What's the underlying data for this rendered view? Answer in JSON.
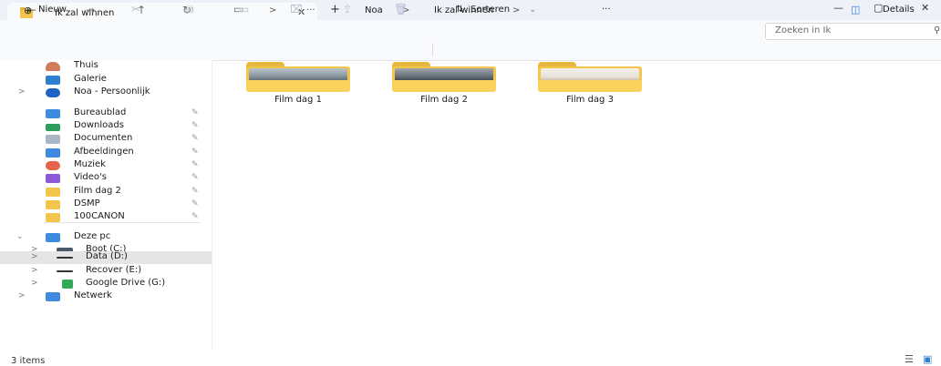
{
  "tab": {
    "title": "Ik zal winnen",
    "close": "✕",
    "add": "+"
  },
  "window": {
    "minimize": "—",
    "maximize": "▢",
    "close": "✕"
  },
  "nav": {
    "back": "←",
    "forward": "→",
    "up": "↑",
    "refresh": "↻",
    "view": "▭",
    "more": "···",
    "breadcrumb": [
      "Noa",
      "Ik zal winnen"
    ],
    "sep": ">"
  },
  "search": {
    "placeholder": "Zoeken in Ik",
    "icon": "search-icon"
  },
  "toolbar": {
    "new_label": "Nieuw",
    "sort_label": "Sorteren",
    "more": "···",
    "details_label": "Details"
  },
  "sidebar": {
    "top": [
      {
        "label": "Thuis",
        "color": "#d07b5a"
      },
      {
        "label": "Galerie",
        "color": "#2f7fd1"
      },
      {
        "label": "Noa - Persoonlijk",
        "color": "#1f64c4"
      }
    ],
    "pinned": [
      {
        "label": "Bureaublad",
        "color": "#3c8be0"
      },
      {
        "label": "Downloads",
        "color": "#2e9e5a"
      },
      {
        "label": "Documenten",
        "color": "#a9b6c8"
      },
      {
        "label": "Afbeeldingen",
        "color": "#3c8be0"
      },
      {
        "label": "Muziek",
        "color": "#e8624c"
      },
      {
        "label": "Video's",
        "color": "#8f57d9"
      },
      {
        "label": "Film dag 2",
        "color": "#f3c64b"
      },
      {
        "label": "DSMP",
        "color": "#f3c64b"
      },
      {
        "label": "100CANON",
        "color": "#f3c64b"
      }
    ],
    "this_pc": {
      "label": "Deze pc",
      "color": "#3c8be0"
    },
    "drives": [
      {
        "label": "Boot (C:)",
        "color": "#4a5a6a"
      },
      {
        "label": "Data (D:)",
        "color": "#333333"
      },
      {
        "label": "Recover (E:)",
        "color": "#333333"
      },
      {
        "label": "Google Drive (G:)",
        "color": "#34a853"
      }
    ],
    "network": {
      "label": "Netwerk",
      "color": "#3c8be0"
    }
  },
  "folders": [
    {
      "label": "Film dag 1"
    },
    {
      "label": "Film dag 2"
    },
    {
      "label": "Film dag 3"
    }
  ],
  "status": {
    "items": "3 items"
  }
}
